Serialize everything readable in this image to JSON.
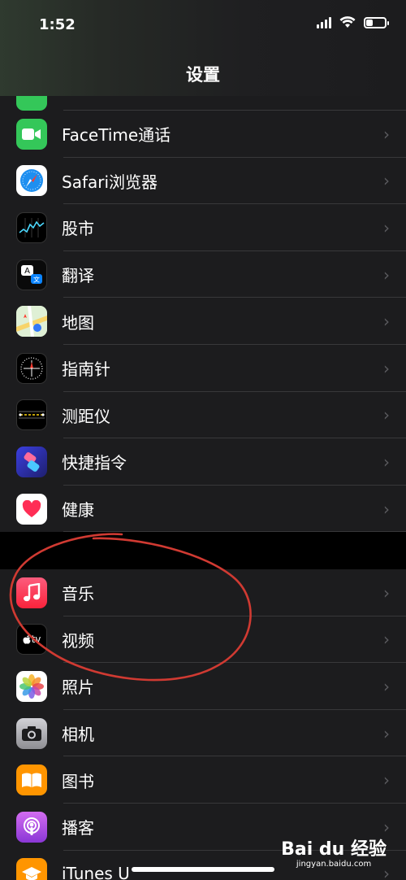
{
  "status_bar": {
    "time": "1:52",
    "battery_level": 0.35
  },
  "nav": {
    "title": "设置"
  },
  "section_a": [
    {
      "label": "FaceTime通话",
      "icon": "facetime-icon",
      "color": "#34c759"
    },
    {
      "label": "Safari浏览器",
      "icon": "safari-icon",
      "color": "#ffffff"
    },
    {
      "label": "股市",
      "icon": "stocks-icon",
      "color": "#000000"
    },
    {
      "label": "翻译",
      "icon": "translate-icon",
      "color": "#0a0a0a"
    },
    {
      "label": "地图",
      "icon": "maps-icon",
      "color": "#e8f3e1"
    },
    {
      "label": "指南针",
      "icon": "compass-icon",
      "color": "#000000"
    },
    {
      "label": "测距仪",
      "icon": "measure-icon",
      "color": "#000000"
    },
    {
      "label": "快捷指令",
      "icon": "shortcuts-icon",
      "color": "#3b3fe0"
    },
    {
      "label": "健康",
      "icon": "health-icon",
      "color": "#ffffff"
    }
  ],
  "section_b": [
    {
      "label": "音乐",
      "icon": "music-icon",
      "color": "#fa3d57"
    },
    {
      "label": "视频",
      "icon": "tv-icon",
      "color": "#000000"
    },
    {
      "label": "照片",
      "icon": "photos-icon",
      "color": "#ffffff"
    },
    {
      "label": "相机",
      "icon": "camera-icon",
      "color": "#8e8e93"
    },
    {
      "label": "图书",
      "icon": "books-icon",
      "color": "#ff9500"
    },
    {
      "label": "播客",
      "icon": "podcasts-icon",
      "color": "#a44ee0"
    },
    {
      "label": "iTunes U",
      "icon": "itunes-u-icon",
      "color": "#ff9500"
    }
  ],
  "chevron": "›",
  "icon_glyphs": {
    "tv": "tv"
  },
  "watermark": {
    "logo": "Bai du 经验",
    "url": "jingyan.baidu.com"
  },
  "annotation_color": "#d03a32"
}
